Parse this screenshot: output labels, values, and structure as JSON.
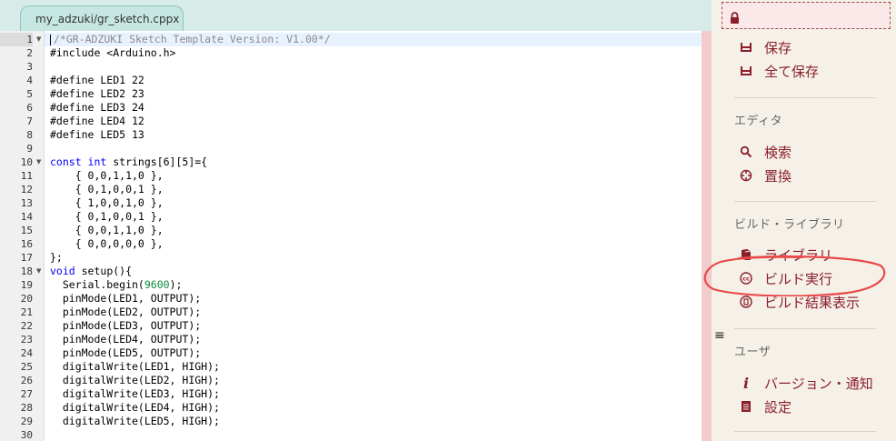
{
  "tab": {
    "title": "my_adzuki/gr_sketch.cpp",
    "close": "x"
  },
  "editor": {
    "lines": [
      {
        "n": "1",
        "fold": true,
        "segs": [
          [
            "cmt",
            "/*GR-ADZUKI Sketch Template Version: V1.00*/"
          ]
        ]
      },
      {
        "n": "2",
        "segs": [
          [
            "",
            "#include <Arduino.h>"
          ]
        ]
      },
      {
        "n": "3",
        "segs": []
      },
      {
        "n": "4",
        "segs": [
          [
            "",
            "#define LED1 22"
          ]
        ]
      },
      {
        "n": "5",
        "segs": [
          [
            "",
            "#define LED2 23"
          ]
        ]
      },
      {
        "n": "6",
        "segs": [
          [
            "",
            "#define LED3 24"
          ]
        ]
      },
      {
        "n": "7",
        "segs": [
          [
            "",
            "#define LED4 12"
          ]
        ]
      },
      {
        "n": "8",
        "segs": [
          [
            "",
            "#define LED5 13"
          ]
        ]
      },
      {
        "n": "9",
        "segs": []
      },
      {
        "n": "10",
        "fold": true,
        "segs": [
          [
            "kw",
            "const int"
          ],
          [
            "",
            " strings[6][5]={"
          ]
        ]
      },
      {
        "n": "11",
        "segs": [
          [
            "",
            "    { 0,0,1,1,0 },"
          ]
        ]
      },
      {
        "n": "12",
        "segs": [
          [
            "",
            "    { 0,1,0,0,1 },"
          ]
        ]
      },
      {
        "n": "13",
        "segs": [
          [
            "",
            "    { 1,0,0,1,0 },"
          ]
        ]
      },
      {
        "n": "14",
        "segs": [
          [
            "",
            "    { 0,1,0,0,1 },"
          ]
        ]
      },
      {
        "n": "15",
        "segs": [
          [
            "",
            "    { 0,0,1,1,0 },"
          ]
        ]
      },
      {
        "n": "16",
        "segs": [
          [
            "",
            "    { 0,0,0,0,0 },"
          ]
        ]
      },
      {
        "n": "17",
        "segs": [
          [
            "",
            "};"
          ]
        ]
      },
      {
        "n": "18",
        "fold": true,
        "segs": [
          [
            "kw",
            "void"
          ],
          [
            "",
            " setup(){"
          ]
        ]
      },
      {
        "n": "19",
        "segs": [
          [
            "",
            "  Serial.begin("
          ],
          [
            "num",
            "9600"
          ],
          [
            "",
            ");"
          ]
        ]
      },
      {
        "n": "20",
        "segs": [
          [
            "",
            "  pinMode(LED1, OUTPUT);"
          ]
        ]
      },
      {
        "n": "21",
        "segs": [
          [
            "",
            "  pinMode(LED2, OUTPUT);"
          ]
        ]
      },
      {
        "n": "22",
        "segs": [
          [
            "",
            "  pinMode(LED3, OUTPUT);"
          ]
        ]
      },
      {
        "n": "23",
        "segs": [
          [
            "",
            "  pinMode(LED4, OUTPUT);"
          ]
        ]
      },
      {
        "n": "24",
        "segs": [
          [
            "",
            "  pinMode(LED5, OUTPUT);"
          ]
        ]
      },
      {
        "n": "25",
        "segs": [
          [
            "",
            "  digitalWrite(LED1, HIGH);"
          ]
        ]
      },
      {
        "n": "26",
        "segs": [
          [
            "",
            "  digitalWrite(LED2, HIGH);"
          ]
        ]
      },
      {
        "n": "27",
        "segs": [
          [
            "",
            "  digitalWrite(LED3, HIGH);"
          ]
        ]
      },
      {
        "n": "28",
        "segs": [
          [
            "",
            "  digitalWrite(LED4, HIGH);"
          ]
        ]
      },
      {
        "n": "29",
        "segs": [
          [
            "",
            "  digitalWrite(LED5, HIGH);"
          ]
        ]
      },
      {
        "n": "30",
        "segs": []
      }
    ]
  },
  "sidebar": {
    "file": {
      "save": "保存",
      "save_all": "全て保存"
    },
    "editor_section": {
      "title": "エディタ",
      "search": "検索",
      "replace": "置換"
    },
    "build_section": {
      "title": "ビルド・ライブラリ",
      "library": "ライブラリ",
      "build_run": "ビルド実行",
      "build_result": "ビルド結果表示"
    },
    "user_section": {
      "title": "ユーザ",
      "version_notice": "バージョン・通知",
      "settings": "設定"
    },
    "icons": {
      "lock": "lock-icon",
      "save": "save-icon",
      "save_all": "save-all-icon",
      "search": "search-icon",
      "replace": "crosshair-icon",
      "library": "book-icon",
      "build_run": "cc-icon",
      "build_result": "result-icon",
      "version": "info-icon",
      "settings": "document-icon",
      "menu": "menu-icon"
    },
    "accent_color": "#8a1f2c",
    "annotation_color": "#e84a4a"
  }
}
